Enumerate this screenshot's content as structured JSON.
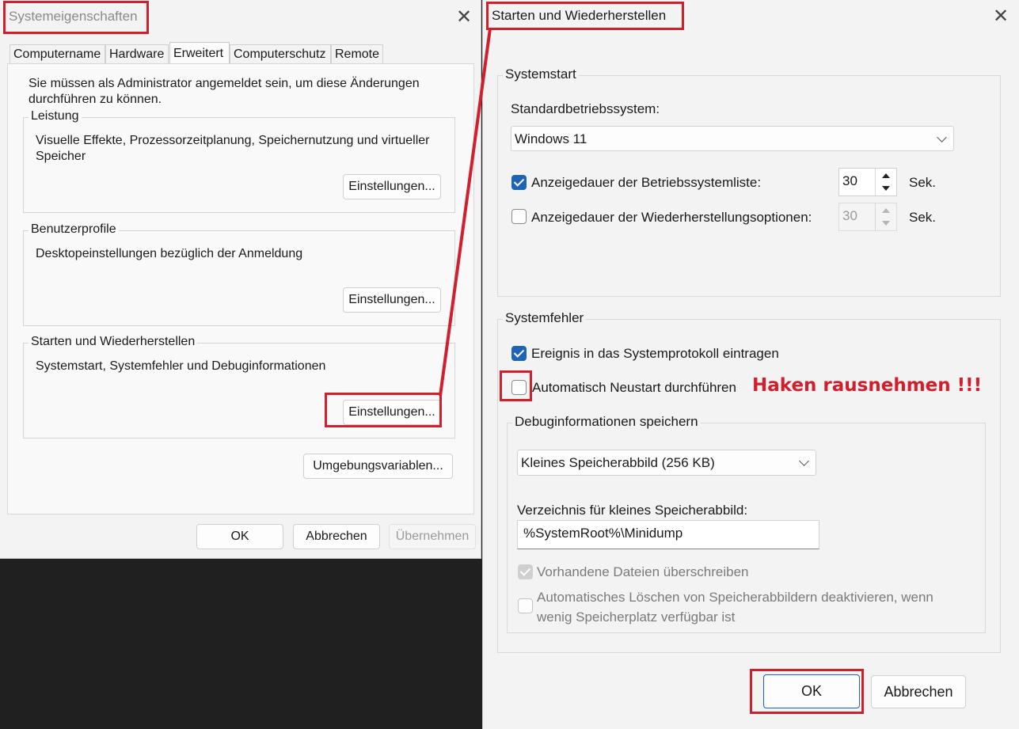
{
  "left_window": {
    "title": "Systemeigenschaften",
    "close_glyph": "✕",
    "tabs": [
      {
        "label": "Computername"
      },
      {
        "label": "Hardware"
      },
      {
        "label": "Erweitert"
      },
      {
        "label": "Computerschutz"
      },
      {
        "label": "Remote"
      }
    ],
    "active_tab": "Erweitert",
    "admin_notice": "Sie müssen als Administrator angemeldet sein, um diese Änderungen durchführen zu können.",
    "groups": [
      {
        "title": "Leistung",
        "description": "Visuelle Effekte, Prozessorzeitplanung, Speichernutzung und virtueller Speicher",
        "button": "Einstellungen..."
      },
      {
        "title": "Benutzerprofile",
        "description": "Desktopeinstellungen bezüglich der Anmeldung",
        "button": "Einstellungen..."
      },
      {
        "title": "Starten und Wiederherstellen",
        "description": "Systemstart, Systemfehler und Debuginformationen",
        "button": "Einstellungen..."
      }
    ],
    "env_button": "Umgebungsvariablen...",
    "ok": "OK",
    "cancel": "Abbrechen",
    "apply": "Übernehmen"
  },
  "right_window": {
    "title": "Starten und Wiederherstellen",
    "close_glyph": "✕",
    "systemstart": {
      "group_title": "Systemstart",
      "default_os_label": "Standardbetriebssystem:",
      "default_os_value": "Windows 11",
      "os_list_label": "Anzeigedauer der Betriebssystemliste:",
      "os_list_checked": true,
      "os_list_value": "30",
      "recovery_label": "Anzeigedauer der Wiederherstellungsoptionen:",
      "recovery_checked": false,
      "recovery_value": "30",
      "unit": "Sek."
    },
    "systemfehler": {
      "group_title": "Systemfehler",
      "log_event_label": "Ereignis in das Systemprotokoll eintragen",
      "log_event_checked": true,
      "auto_restart_label": "Automatisch Neustart durchführen",
      "auto_restart_checked": false,
      "annotation": "Haken rausnehmen !!!",
      "debug": {
        "group_title": "Debuginformationen speichern",
        "dump_type": "Kleines Speicherabbild (256 KB)",
        "dir_label": "Verzeichnis für kleines Speicherabbild:",
        "dir_value": "%SystemRoot%\\Minidump",
        "overwrite_label": "Vorhandene Dateien überschreiben",
        "overwrite_checked": true,
        "disable_autodelete_label_line1": "Automatisches Löschen von Speicherabbildern deaktivieren, wenn",
        "disable_autodelete_label_line2": "wenig Speicherplatz verfügbar ist",
        "disable_autodelete_checked": false
      }
    },
    "ok": "OK",
    "cancel": "Abbrechen"
  },
  "colors": {
    "highlight_red": "#d0202e",
    "checkbox_blue": "#1f63b5",
    "background_dark": "#202020"
  }
}
